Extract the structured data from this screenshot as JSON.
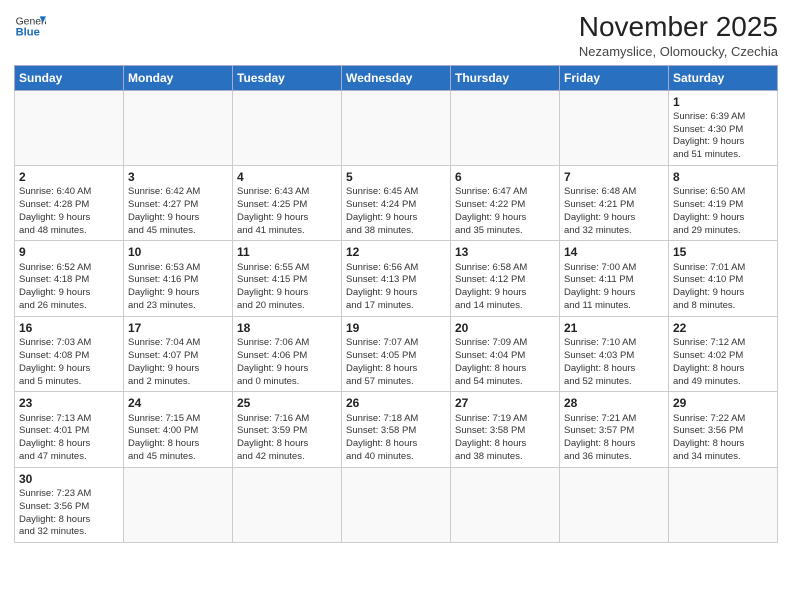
{
  "logo": {
    "line1": "General",
    "line2": "Blue"
  },
  "title": "November 2025",
  "subtitle": "Nezamyslice, Olomoucky, Czechia",
  "weekdays": [
    "Sunday",
    "Monday",
    "Tuesday",
    "Wednesday",
    "Thursday",
    "Friday",
    "Saturday"
  ],
  "weeks": [
    [
      {
        "day": "",
        "info": ""
      },
      {
        "day": "",
        "info": ""
      },
      {
        "day": "",
        "info": ""
      },
      {
        "day": "",
        "info": ""
      },
      {
        "day": "",
        "info": ""
      },
      {
        "day": "",
        "info": ""
      },
      {
        "day": "1",
        "info": "Sunrise: 6:39 AM\nSunset: 4:30 PM\nDaylight: 9 hours\nand 51 minutes."
      }
    ],
    [
      {
        "day": "2",
        "info": "Sunrise: 6:40 AM\nSunset: 4:28 PM\nDaylight: 9 hours\nand 48 minutes."
      },
      {
        "day": "3",
        "info": "Sunrise: 6:42 AM\nSunset: 4:27 PM\nDaylight: 9 hours\nand 45 minutes."
      },
      {
        "day": "4",
        "info": "Sunrise: 6:43 AM\nSunset: 4:25 PM\nDaylight: 9 hours\nand 41 minutes."
      },
      {
        "day": "5",
        "info": "Sunrise: 6:45 AM\nSunset: 4:24 PM\nDaylight: 9 hours\nand 38 minutes."
      },
      {
        "day": "6",
        "info": "Sunrise: 6:47 AM\nSunset: 4:22 PM\nDaylight: 9 hours\nand 35 minutes."
      },
      {
        "day": "7",
        "info": "Sunrise: 6:48 AM\nSunset: 4:21 PM\nDaylight: 9 hours\nand 32 minutes."
      },
      {
        "day": "8",
        "info": "Sunrise: 6:50 AM\nSunset: 4:19 PM\nDaylight: 9 hours\nand 29 minutes."
      }
    ],
    [
      {
        "day": "9",
        "info": "Sunrise: 6:52 AM\nSunset: 4:18 PM\nDaylight: 9 hours\nand 26 minutes."
      },
      {
        "day": "10",
        "info": "Sunrise: 6:53 AM\nSunset: 4:16 PM\nDaylight: 9 hours\nand 23 minutes."
      },
      {
        "day": "11",
        "info": "Sunrise: 6:55 AM\nSunset: 4:15 PM\nDaylight: 9 hours\nand 20 minutes."
      },
      {
        "day": "12",
        "info": "Sunrise: 6:56 AM\nSunset: 4:13 PM\nDaylight: 9 hours\nand 17 minutes."
      },
      {
        "day": "13",
        "info": "Sunrise: 6:58 AM\nSunset: 4:12 PM\nDaylight: 9 hours\nand 14 minutes."
      },
      {
        "day": "14",
        "info": "Sunrise: 7:00 AM\nSunset: 4:11 PM\nDaylight: 9 hours\nand 11 minutes."
      },
      {
        "day": "15",
        "info": "Sunrise: 7:01 AM\nSunset: 4:10 PM\nDaylight: 9 hours\nand 8 minutes."
      }
    ],
    [
      {
        "day": "16",
        "info": "Sunrise: 7:03 AM\nSunset: 4:08 PM\nDaylight: 9 hours\nand 5 minutes."
      },
      {
        "day": "17",
        "info": "Sunrise: 7:04 AM\nSunset: 4:07 PM\nDaylight: 9 hours\nand 2 minutes."
      },
      {
        "day": "18",
        "info": "Sunrise: 7:06 AM\nSunset: 4:06 PM\nDaylight: 9 hours\nand 0 minutes."
      },
      {
        "day": "19",
        "info": "Sunrise: 7:07 AM\nSunset: 4:05 PM\nDaylight: 8 hours\nand 57 minutes."
      },
      {
        "day": "20",
        "info": "Sunrise: 7:09 AM\nSunset: 4:04 PM\nDaylight: 8 hours\nand 54 minutes."
      },
      {
        "day": "21",
        "info": "Sunrise: 7:10 AM\nSunset: 4:03 PM\nDaylight: 8 hours\nand 52 minutes."
      },
      {
        "day": "22",
        "info": "Sunrise: 7:12 AM\nSunset: 4:02 PM\nDaylight: 8 hours\nand 49 minutes."
      }
    ],
    [
      {
        "day": "23",
        "info": "Sunrise: 7:13 AM\nSunset: 4:01 PM\nDaylight: 8 hours\nand 47 minutes."
      },
      {
        "day": "24",
        "info": "Sunrise: 7:15 AM\nSunset: 4:00 PM\nDaylight: 8 hours\nand 45 minutes."
      },
      {
        "day": "25",
        "info": "Sunrise: 7:16 AM\nSunset: 3:59 PM\nDaylight: 8 hours\nand 42 minutes."
      },
      {
        "day": "26",
        "info": "Sunrise: 7:18 AM\nSunset: 3:58 PM\nDaylight: 8 hours\nand 40 minutes."
      },
      {
        "day": "27",
        "info": "Sunrise: 7:19 AM\nSunset: 3:58 PM\nDaylight: 8 hours\nand 38 minutes."
      },
      {
        "day": "28",
        "info": "Sunrise: 7:21 AM\nSunset: 3:57 PM\nDaylight: 8 hours\nand 36 minutes."
      },
      {
        "day": "29",
        "info": "Sunrise: 7:22 AM\nSunset: 3:56 PM\nDaylight: 8 hours\nand 34 minutes."
      }
    ],
    [
      {
        "day": "30",
        "info": "Sunrise: 7:23 AM\nSunset: 3:56 PM\nDaylight: 8 hours\nand 32 minutes."
      },
      {
        "day": "",
        "info": ""
      },
      {
        "day": "",
        "info": ""
      },
      {
        "day": "",
        "info": ""
      },
      {
        "day": "",
        "info": ""
      },
      {
        "day": "",
        "info": ""
      },
      {
        "day": "",
        "info": ""
      }
    ]
  ]
}
